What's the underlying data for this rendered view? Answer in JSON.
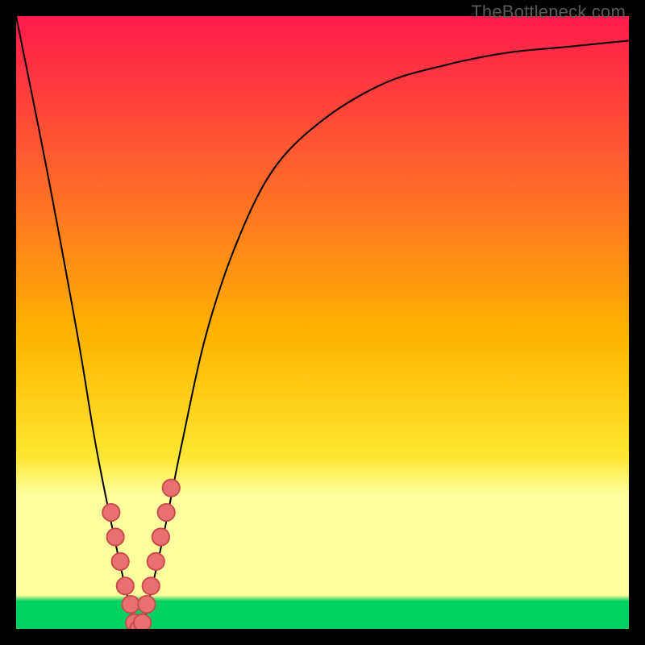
{
  "watermark": "TheBottleneck.com",
  "colors": {
    "top": "#ff1a4b",
    "mid1": "#ff6a29",
    "mid2": "#ffb400",
    "mid3": "#ffe733",
    "band": "#ffff9d",
    "green": "#00d060",
    "black": "#000000",
    "curve": "#000000",
    "marker_fill": "#e87070",
    "marker_stroke": "#c84a4a"
  },
  "chart_data": {
    "type": "line",
    "title": "",
    "xlabel": "",
    "ylabel": "",
    "xlim": [
      0,
      100
    ],
    "ylim": [
      0,
      100
    ],
    "series": [
      {
        "name": "bottleneck-curve",
        "x": [
          0,
          5,
          10,
          13,
          16,
          18,
          19,
          20,
          21,
          22,
          24,
          27,
          31,
          36,
          42,
          50,
          60,
          70,
          80,
          90,
          100
        ],
        "values": [
          100,
          75,
          48,
          30,
          15,
          6,
          2,
          0,
          2,
          6,
          15,
          30,
          48,
          63,
          75,
          83,
          89,
          92,
          94,
          95,
          96
        ]
      }
    ],
    "markers": {
      "name": "highlighted-points",
      "x": [
        15.5,
        16.2,
        17.0,
        17.8,
        18.7,
        19.3,
        20.0,
        20.6,
        21.3,
        22.0,
        22.8,
        23.6,
        24.5,
        25.3
      ],
      "values": [
        19,
        15,
        11,
        7,
        4,
        1,
        0,
        1,
        4,
        7,
        11,
        15,
        19,
        23
      ]
    }
  }
}
